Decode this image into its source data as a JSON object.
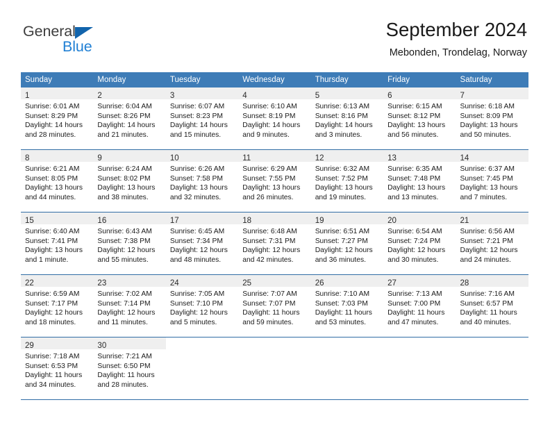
{
  "brand": {
    "name_top": "General",
    "name_bottom": "Blue",
    "accent_color": "#1f7fd4",
    "triangle_color": "#1264ac"
  },
  "header": {
    "title": "September 2024",
    "subtitle": "Mebonden, Trondelag, Norway"
  },
  "theme": {
    "header_row_bg": "#3e7cb7",
    "daynum_band_bg": "#efefef",
    "row_separator": "#2f6ca5"
  },
  "weekdays": [
    "Sunday",
    "Monday",
    "Tuesday",
    "Wednesday",
    "Thursday",
    "Friday",
    "Saturday"
  ],
  "weeks": [
    [
      {
        "day": "1",
        "sunrise": "Sunrise: 6:01 AM",
        "sunset": "Sunset: 8:29 PM",
        "daylight_1": "Daylight: 14 hours",
        "daylight_2": "and 28 minutes."
      },
      {
        "day": "2",
        "sunrise": "Sunrise: 6:04 AM",
        "sunset": "Sunset: 8:26 PM",
        "daylight_1": "Daylight: 14 hours",
        "daylight_2": "and 21 minutes."
      },
      {
        "day": "3",
        "sunrise": "Sunrise: 6:07 AM",
        "sunset": "Sunset: 8:23 PM",
        "daylight_1": "Daylight: 14 hours",
        "daylight_2": "and 15 minutes."
      },
      {
        "day": "4",
        "sunrise": "Sunrise: 6:10 AM",
        "sunset": "Sunset: 8:19 PM",
        "daylight_1": "Daylight: 14 hours",
        "daylight_2": "and 9 minutes."
      },
      {
        "day": "5",
        "sunrise": "Sunrise: 6:13 AM",
        "sunset": "Sunset: 8:16 PM",
        "daylight_1": "Daylight: 14 hours",
        "daylight_2": "and 3 minutes."
      },
      {
        "day": "6",
        "sunrise": "Sunrise: 6:15 AM",
        "sunset": "Sunset: 8:12 PM",
        "daylight_1": "Daylight: 13 hours",
        "daylight_2": "and 56 minutes."
      },
      {
        "day": "7",
        "sunrise": "Sunrise: 6:18 AM",
        "sunset": "Sunset: 8:09 PM",
        "daylight_1": "Daylight: 13 hours",
        "daylight_2": "and 50 minutes."
      }
    ],
    [
      {
        "day": "8",
        "sunrise": "Sunrise: 6:21 AM",
        "sunset": "Sunset: 8:05 PM",
        "daylight_1": "Daylight: 13 hours",
        "daylight_2": "and 44 minutes."
      },
      {
        "day": "9",
        "sunrise": "Sunrise: 6:24 AM",
        "sunset": "Sunset: 8:02 PM",
        "daylight_1": "Daylight: 13 hours",
        "daylight_2": "and 38 minutes."
      },
      {
        "day": "10",
        "sunrise": "Sunrise: 6:26 AM",
        "sunset": "Sunset: 7:58 PM",
        "daylight_1": "Daylight: 13 hours",
        "daylight_2": "and 32 minutes."
      },
      {
        "day": "11",
        "sunrise": "Sunrise: 6:29 AM",
        "sunset": "Sunset: 7:55 PM",
        "daylight_1": "Daylight: 13 hours",
        "daylight_2": "and 26 minutes."
      },
      {
        "day": "12",
        "sunrise": "Sunrise: 6:32 AM",
        "sunset": "Sunset: 7:52 PM",
        "daylight_1": "Daylight: 13 hours",
        "daylight_2": "and 19 minutes."
      },
      {
        "day": "13",
        "sunrise": "Sunrise: 6:35 AM",
        "sunset": "Sunset: 7:48 PM",
        "daylight_1": "Daylight: 13 hours",
        "daylight_2": "and 13 minutes."
      },
      {
        "day": "14",
        "sunrise": "Sunrise: 6:37 AM",
        "sunset": "Sunset: 7:45 PM",
        "daylight_1": "Daylight: 13 hours",
        "daylight_2": "and 7 minutes."
      }
    ],
    [
      {
        "day": "15",
        "sunrise": "Sunrise: 6:40 AM",
        "sunset": "Sunset: 7:41 PM",
        "daylight_1": "Daylight: 13 hours",
        "daylight_2": "and 1 minute."
      },
      {
        "day": "16",
        "sunrise": "Sunrise: 6:43 AM",
        "sunset": "Sunset: 7:38 PM",
        "daylight_1": "Daylight: 12 hours",
        "daylight_2": "and 55 minutes."
      },
      {
        "day": "17",
        "sunrise": "Sunrise: 6:45 AM",
        "sunset": "Sunset: 7:34 PM",
        "daylight_1": "Daylight: 12 hours",
        "daylight_2": "and 48 minutes."
      },
      {
        "day": "18",
        "sunrise": "Sunrise: 6:48 AM",
        "sunset": "Sunset: 7:31 PM",
        "daylight_1": "Daylight: 12 hours",
        "daylight_2": "and 42 minutes."
      },
      {
        "day": "19",
        "sunrise": "Sunrise: 6:51 AM",
        "sunset": "Sunset: 7:27 PM",
        "daylight_1": "Daylight: 12 hours",
        "daylight_2": "and 36 minutes."
      },
      {
        "day": "20",
        "sunrise": "Sunrise: 6:54 AM",
        "sunset": "Sunset: 7:24 PM",
        "daylight_1": "Daylight: 12 hours",
        "daylight_2": "and 30 minutes."
      },
      {
        "day": "21",
        "sunrise": "Sunrise: 6:56 AM",
        "sunset": "Sunset: 7:21 PM",
        "daylight_1": "Daylight: 12 hours",
        "daylight_2": "and 24 minutes."
      }
    ],
    [
      {
        "day": "22",
        "sunrise": "Sunrise: 6:59 AM",
        "sunset": "Sunset: 7:17 PM",
        "daylight_1": "Daylight: 12 hours",
        "daylight_2": "and 18 minutes."
      },
      {
        "day": "23",
        "sunrise": "Sunrise: 7:02 AM",
        "sunset": "Sunset: 7:14 PM",
        "daylight_1": "Daylight: 12 hours",
        "daylight_2": "and 11 minutes."
      },
      {
        "day": "24",
        "sunrise": "Sunrise: 7:05 AM",
        "sunset": "Sunset: 7:10 PM",
        "daylight_1": "Daylight: 12 hours",
        "daylight_2": "and 5 minutes."
      },
      {
        "day": "25",
        "sunrise": "Sunrise: 7:07 AM",
        "sunset": "Sunset: 7:07 PM",
        "daylight_1": "Daylight: 11 hours",
        "daylight_2": "and 59 minutes."
      },
      {
        "day": "26",
        "sunrise": "Sunrise: 7:10 AM",
        "sunset": "Sunset: 7:03 PM",
        "daylight_1": "Daylight: 11 hours",
        "daylight_2": "and 53 minutes."
      },
      {
        "day": "27",
        "sunrise": "Sunrise: 7:13 AM",
        "sunset": "Sunset: 7:00 PM",
        "daylight_1": "Daylight: 11 hours",
        "daylight_2": "and 47 minutes."
      },
      {
        "day": "28",
        "sunrise": "Sunrise: 7:16 AM",
        "sunset": "Sunset: 6:57 PM",
        "daylight_1": "Daylight: 11 hours",
        "daylight_2": "and 40 minutes."
      }
    ],
    [
      {
        "day": "29",
        "sunrise": "Sunrise: 7:18 AM",
        "sunset": "Sunset: 6:53 PM",
        "daylight_1": "Daylight: 11 hours",
        "daylight_2": "and 34 minutes."
      },
      {
        "day": "30",
        "sunrise": "Sunrise: 7:21 AM",
        "sunset": "Sunset: 6:50 PM",
        "daylight_1": "Daylight: 11 hours",
        "daylight_2": "and 28 minutes."
      },
      {
        "day": "",
        "sunrise": "",
        "sunset": "",
        "daylight_1": "",
        "daylight_2": ""
      },
      {
        "day": "",
        "sunrise": "",
        "sunset": "",
        "daylight_1": "",
        "daylight_2": ""
      },
      {
        "day": "",
        "sunrise": "",
        "sunset": "",
        "daylight_1": "",
        "daylight_2": ""
      },
      {
        "day": "",
        "sunrise": "",
        "sunset": "",
        "daylight_1": "",
        "daylight_2": ""
      },
      {
        "day": "",
        "sunrise": "",
        "sunset": "",
        "daylight_1": "",
        "daylight_2": ""
      }
    ]
  ]
}
